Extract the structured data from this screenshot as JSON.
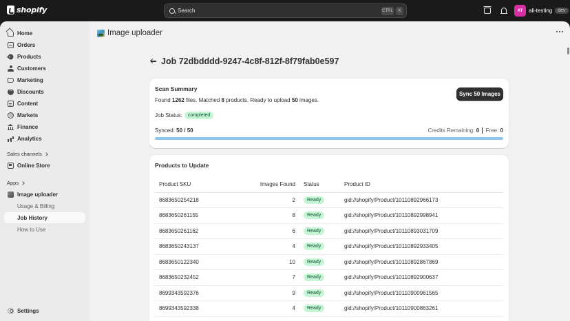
{
  "topbar": {
    "brand": "shopify",
    "search_placeholder": "Search",
    "shortcut_ctrl": "CTRL",
    "shortcut_key": "K",
    "avatar_initials": "AT",
    "store_name": "ali-testing",
    "store_badge": "dev"
  },
  "sidebar": {
    "items": [
      {
        "label": "Home",
        "icon": "home-icon"
      },
      {
        "label": "Orders",
        "icon": "orders-icon"
      },
      {
        "label": "Products",
        "icon": "tag-icon"
      },
      {
        "label": "Customers",
        "icon": "person-icon"
      },
      {
        "label": "Marketing",
        "icon": "target-icon"
      },
      {
        "label": "Discounts",
        "icon": "discount-icon"
      },
      {
        "label": "Content",
        "icon": "content-icon"
      },
      {
        "label": "Markets",
        "icon": "globe-icon"
      },
      {
        "label": "Finance",
        "icon": "bank-icon"
      },
      {
        "label": "Analytics",
        "icon": "chart-icon"
      }
    ],
    "sales_channels_label": "Sales channels",
    "online_store": "Online Store",
    "apps_label": "Apps",
    "app_name": "Image uploader",
    "app_subitems": [
      "Usage & Billing",
      "Job History",
      "How to Use"
    ],
    "settings": "Settings"
  },
  "header": {
    "app_title": "Image uploader"
  },
  "job": {
    "title": "Job 72dbdddd-9247-4c8f-812f-8f79fab0e597"
  },
  "summary": {
    "title": "Scan Summary",
    "sync_button": "Sync 50 Images",
    "found_prefix": "Found",
    "files": "1262",
    "files_suffix": "files. Matched",
    "products": "8",
    "products_suffix": "products. Ready to upload",
    "images": "50",
    "images_suffix": "images.",
    "status_label": "Job Status:",
    "status_value": "completed",
    "synced_label": "Synced:",
    "synced_value": "50 / 50",
    "credits_label": "Credits Remaining:",
    "credits_value": "0",
    "free_label": "Free:",
    "free_value": "0",
    "progress": 1.0
  },
  "products": {
    "title": "Products to Update",
    "columns": [
      "Product SKU",
      "Images Found",
      "Status",
      "Product ID"
    ],
    "rows": [
      {
        "sku": "8683650254218",
        "images": "2",
        "status": "Ready",
        "id": "gid://shopify/Product/10110892966173"
      },
      {
        "sku": "8683650261155",
        "images": "8",
        "status": "Ready",
        "id": "gid://shopify/Product/10110892998941"
      },
      {
        "sku": "8683650261162",
        "images": "6",
        "status": "Ready",
        "id": "gid://shopify/Product/10110893031709"
      },
      {
        "sku": "8683650243137",
        "images": "4",
        "status": "Ready",
        "id": "gid://shopify/Product/10110892933405"
      },
      {
        "sku": "8683650122340",
        "images": "10",
        "status": "Ready",
        "id": "gid://shopify/Product/10110892867869"
      },
      {
        "sku": "8683650232452",
        "images": "7",
        "status": "Ready",
        "id": "gid://shopify/Product/10110892900637"
      },
      {
        "sku": "8699343592376",
        "images": "9",
        "status": "Ready",
        "id": "gid://shopify/Product/10110900961565"
      },
      {
        "sku": "8699343592338",
        "images": "4",
        "status": "Ready",
        "id": "gid://shopify/Product/10110900863261"
      }
    ]
  }
}
